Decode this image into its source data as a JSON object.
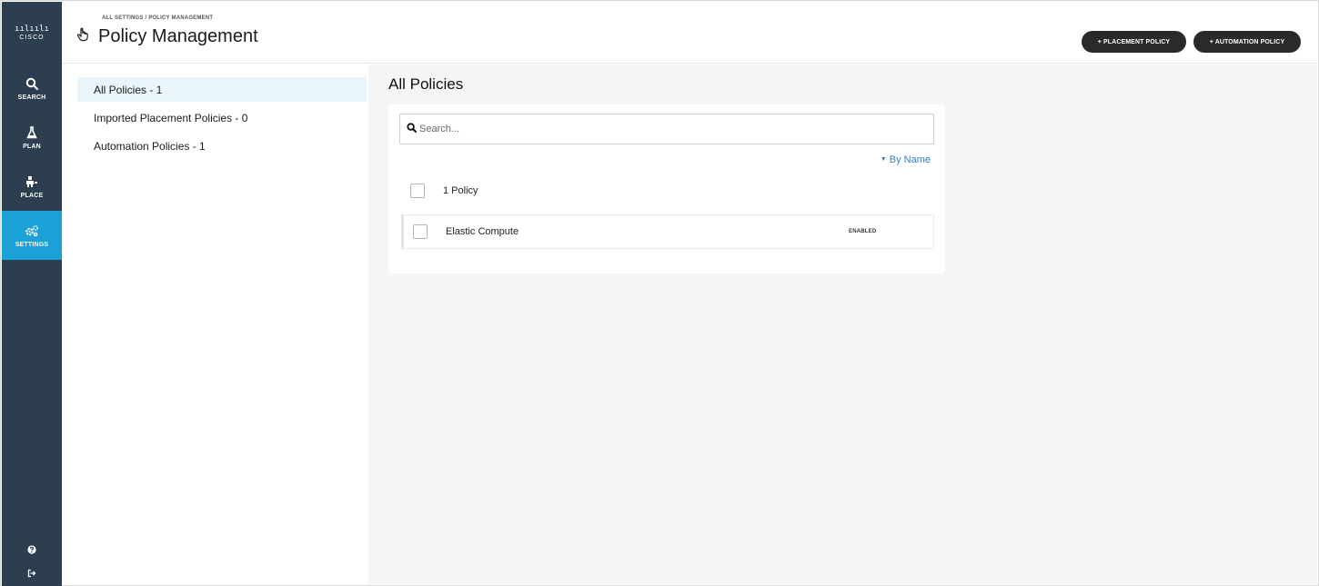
{
  "brand": {
    "bars": "ıılıılı",
    "word": "CISCO"
  },
  "rail": {
    "items": [
      {
        "label": "SEARCH",
        "icon": "search-icon"
      },
      {
        "label": "PLAN",
        "icon": "flask-icon"
      },
      {
        "label": "PLACE",
        "icon": "place-icon"
      },
      {
        "label": "SETTINGS",
        "icon": "gears-icon",
        "active": true
      }
    ],
    "bottom": [
      {
        "icon": "help-icon"
      },
      {
        "icon": "logout-icon"
      }
    ]
  },
  "header": {
    "breadcrumb": "ALL SETTINGS / POLICY MANAGEMENT",
    "title": "Policy Management",
    "buttons": {
      "placement": "+  PLACEMENT POLICY",
      "automation": "+  AUTOMATION POLICY"
    }
  },
  "left_list": {
    "items": [
      {
        "label": "All Policies - 1",
        "selected": true
      },
      {
        "label": "Imported Placement Policies - 0"
      },
      {
        "label": "Automation Policies - 1"
      }
    ]
  },
  "main": {
    "title": "All Policies",
    "search": {
      "placeholder": "Search...",
      "value": ""
    },
    "sort_label": "By Name",
    "count_label": "1 Policy",
    "policies": [
      {
        "name": "Elastic Compute",
        "status": "ENABLED"
      }
    ]
  },
  "colors": {
    "rail_bg": "#2c3e50",
    "rail_active": "#1ba0d7",
    "link": "#2f80c6",
    "button_bg": "#2a2a2a",
    "main_bg": "#f5f5f5"
  }
}
